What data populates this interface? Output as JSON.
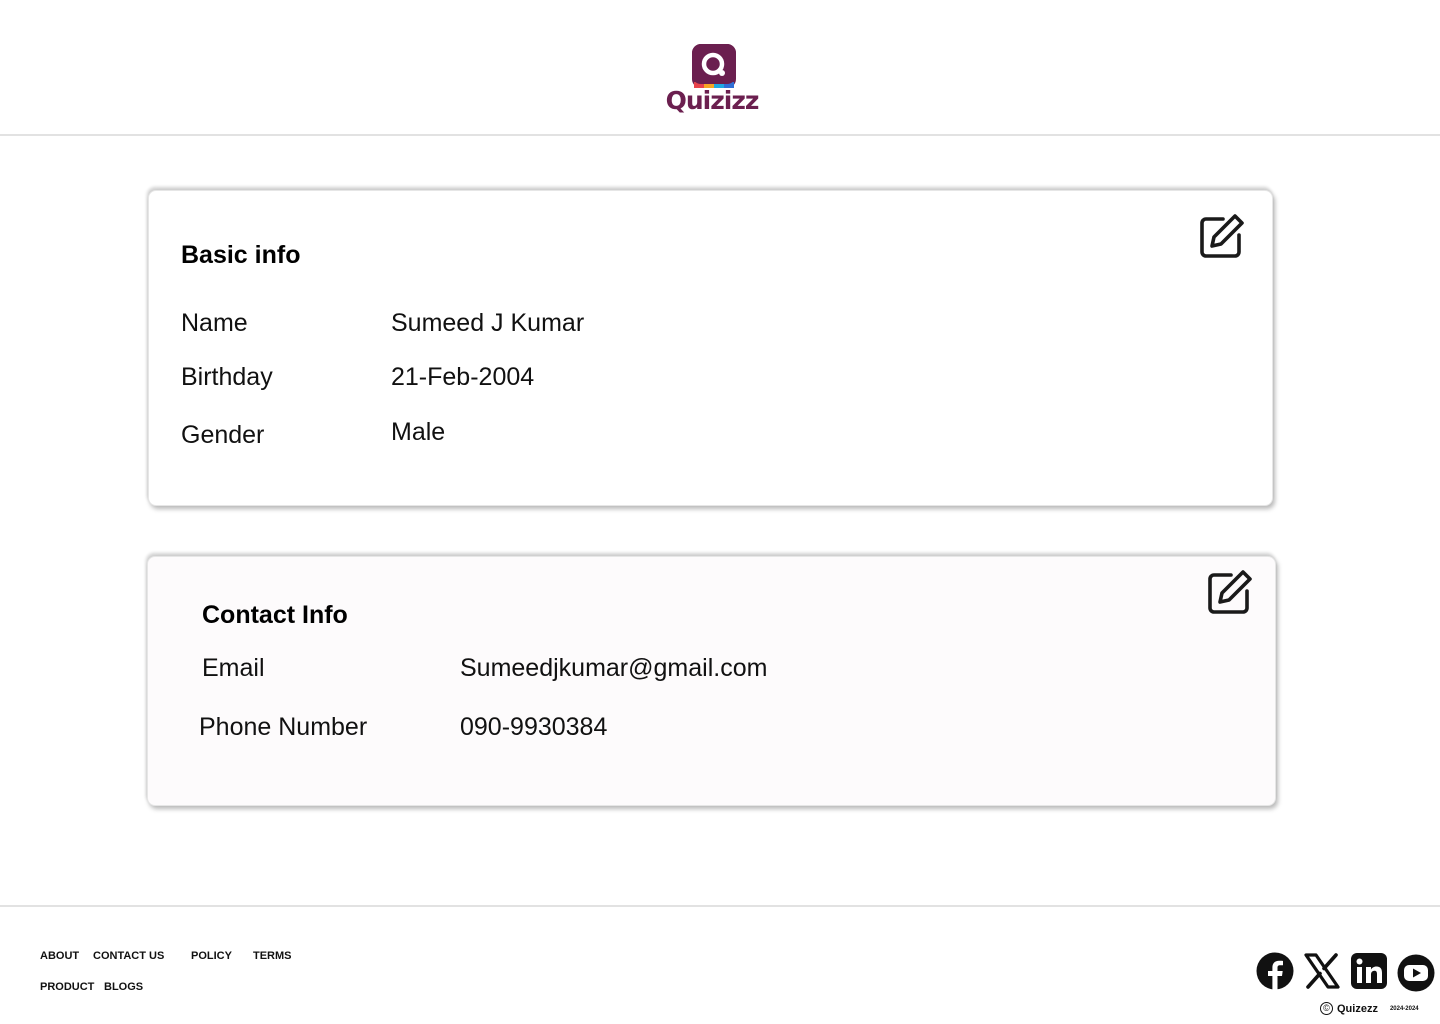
{
  "brand": {
    "name": "Quizizz",
    "color": "#6b1f4f"
  },
  "basic_info": {
    "title": "Basic info",
    "rows": [
      {
        "label": "Name",
        "value": "Sumeed J Kumar"
      },
      {
        "label": "Birthday",
        "value": "21-Feb-2004"
      },
      {
        "label": "Gender",
        "value": "Male"
      }
    ],
    "edit_icon": "edit-icon"
  },
  "contact_info": {
    "title": "Contact Info",
    "rows": [
      {
        "label": "Email",
        "value": "Sumeedjkumar@gmail.com"
      },
      {
        "label": "Phone Number",
        "value": "090-9930384"
      }
    ],
    "edit_icon": "edit-icon"
  },
  "footer": {
    "links_row1": [
      "ABOUT",
      "CONTACT US",
      "POLICY",
      "TERMS"
    ],
    "links_row2": [
      "PRODUCT",
      "BLOGS"
    ],
    "social": [
      "facebook-icon",
      "x-icon",
      "linkedin-icon",
      "youtube-icon"
    ],
    "copyright_symbol": "©",
    "copyright_name": "Quizezz",
    "copyright_years": "2024-2024"
  }
}
